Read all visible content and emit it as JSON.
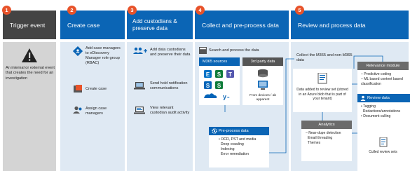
{
  "steps": [
    {
      "number": "1",
      "title": "Trigger event"
    },
    {
      "number": "2",
      "title": "Create case"
    },
    {
      "number": "3",
      "title": "Add custodians & preserve data"
    },
    {
      "number": "4",
      "title": "Collect and pre-process data"
    },
    {
      "number": "5",
      "title": "Review and process data"
    }
  ],
  "trigger": {
    "text": "An internal or external event that creates the need for an investigation"
  },
  "create_case": {
    "items": [
      {
        "icon": "role-group-icon",
        "label": "Add case managers to eDiscovery Manager role group (RBAC)"
      },
      {
        "icon": "case-icon",
        "label": "Create case"
      },
      {
        "icon": "assign-icon",
        "label": "Assign case managers"
      }
    ]
  },
  "custodians": {
    "items": [
      {
        "icon": "add-user-icon",
        "label": "Add data custodians and preserve their data"
      },
      {
        "icon": "laptop-icon",
        "label": "Send hold notification communications"
      },
      {
        "icon": "audit-icon",
        "label": "View relevant custodian audit activity"
      }
    ]
  },
  "collect": {
    "search_label": "Search and process the data",
    "m365_title": "M365 sources",
    "third_party_title": "3rd party data",
    "third_party_caption": "From devices / ab apparent",
    "preprocess_title": "Pre-process data",
    "preprocess_items": [
      "OCR, PST and media",
      "Deep crawling",
      "Indexing",
      "Error remediation"
    ]
  },
  "review": {
    "collect_label": "Collect the M365 and non-M365 data",
    "added_label": "Data added to review set (stored in an Azure blob that is part of your tenant)",
    "analytics_title": "Analytics",
    "analytics_items": [
      "Near-dupe detection",
      "Email threading",
      "Themes"
    ],
    "relevance_title": "Relevance module",
    "relevance_items": [
      "Predictive coding",
      "ML based content based classification"
    ],
    "review_title": "Review data",
    "review_items": [
      "Tagging",
      "Redactions/annotations",
      "Document culling"
    ],
    "culled_label": "Culled review sets"
  },
  "colors": {
    "header_blue": "#0b65b5",
    "badge_orange": "#e8532a",
    "panel_blue": "#dfe9f3",
    "panel_gray": "#d4d4d4"
  }
}
